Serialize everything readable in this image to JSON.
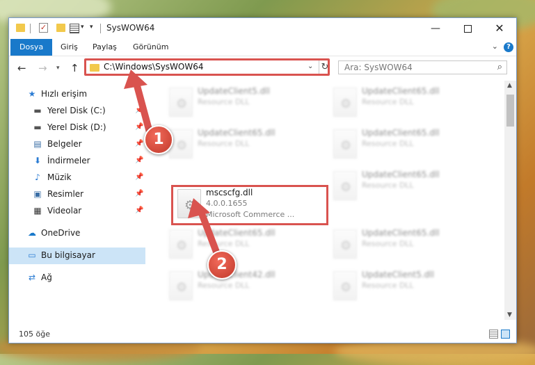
{
  "window": {
    "title": "SysWOW64",
    "controls": {
      "minimize": "—",
      "maximize": "",
      "close": "✕"
    }
  },
  "ribbon": {
    "tabs": [
      "Dosya",
      "Giriş",
      "Paylaş",
      "Görünüm"
    ],
    "help": "?",
    "collapse": "⌄"
  },
  "nav": {
    "back": "←",
    "forward": "→",
    "recent": "▾",
    "up": "↑",
    "address": "C:\\Windows\\SysWOW64",
    "address_dropdown": "⌄",
    "refresh": "↻",
    "search_placeholder": "Ara: SysWOW64",
    "search_icon": "⌕"
  },
  "sidebar": {
    "items": [
      {
        "label": "Hızlı erişim",
        "icon": "star-icon",
        "glyph": "★",
        "color": "#2b7cd3"
      },
      {
        "label": "Yerel Disk (C:)",
        "icon": "drive-icon",
        "glyph": "▬",
        "color": "#555555",
        "pinned": true
      },
      {
        "label": "Yerel Disk (D:)",
        "icon": "drive-icon",
        "glyph": "▬",
        "color": "#555555",
        "pinned": true
      },
      {
        "label": "Belgeler",
        "icon": "documents-icon",
        "glyph": "▤",
        "color": "#3a6ea5",
        "pinned": true
      },
      {
        "label": "İndirmeler",
        "icon": "downloads-icon",
        "glyph": "⬇",
        "color": "#2b7cd3",
        "pinned": true
      },
      {
        "label": "Müzik",
        "icon": "music-icon",
        "glyph": "♪",
        "color": "#2b7cd3",
        "pinned": true
      },
      {
        "label": "Resimler",
        "icon": "pictures-icon",
        "glyph": "▣",
        "color": "#3a6ea5",
        "pinned": true
      },
      {
        "label": "Videolar",
        "icon": "videos-icon",
        "glyph": "▦",
        "color": "#333333",
        "pinned": true
      },
      {
        "label": "OneDrive",
        "icon": "cloud-icon",
        "glyph": "☁",
        "color": "#1979ca"
      },
      {
        "label": "Bu bilgisayar",
        "icon": "computer-icon",
        "glyph": "▭",
        "color": "#2b7cd3",
        "selected": true
      },
      {
        "label": "Ağ",
        "icon": "network-icon",
        "glyph": "⇄",
        "color": "#2b7cd3"
      }
    ],
    "pin_glyph": "📌"
  },
  "files": [
    {
      "name": "UpdateClient5.dll",
      "desc": "Resource DLL",
      "blurred": true
    },
    {
      "name": "UpdateClient65.dll",
      "desc": "Resource DLL",
      "blurred": true
    },
    {
      "name": "UpdateClient65.dll",
      "desc": "Resource DLL",
      "blurred": true
    },
    {
      "name": "UpdateClient65.dll",
      "desc": "Resource DLL",
      "blurred": true
    },
    {
      "name": "mscscfg.dll",
      "version": "4.0.0.1655",
      "desc": "Microsoft Commerce ...",
      "blurred": false
    },
    {
      "name": "UpdateClient65.dll",
      "desc": "Resource DLL",
      "blurred": true
    },
    {
      "name": "UpdateClient65.dll",
      "desc": "Resource DLL",
      "blurred": true
    },
    {
      "name": "UpdateClient65.dll",
      "desc": "Resource DLL",
      "blurred": true
    },
    {
      "name": "UpdateClient42.dll",
      "desc": "Resource DLL",
      "blurred": true
    },
    {
      "name": "UpdateClient5.dll",
      "desc": "Resource DLL",
      "blurred": true
    }
  ],
  "gear_glyph": "⚙",
  "scrollbar": {
    "up": "▲",
    "down": "▼"
  },
  "status": {
    "count": "105 öğe"
  },
  "annotations": {
    "step1": "1",
    "step2": "2",
    "color": "#d9534f"
  }
}
